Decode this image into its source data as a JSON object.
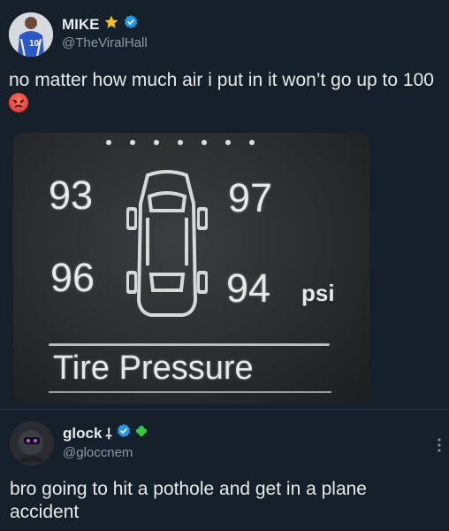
{
  "original_post": {
    "author": {
      "display_name": "MIKE",
      "handle": "@TheViralHall",
      "jersey_number": "10"
    },
    "text": "no matter how much air i put in it won’t go up to 100",
    "media": {
      "pressures": {
        "front_left": "93",
        "front_right": "97",
        "rear_left": "96",
        "rear_right": "94"
      },
      "unit": "psi",
      "label": "Tire Pressure"
    }
  },
  "reply_post": {
    "author": {
      "display_name": "glock",
      "handle": "@gloccnem"
    },
    "text": "bro going to hit a pothole and get in a plane accident"
  },
  "colors": {
    "background": "#15202b",
    "text_primary": "#e7e9ea",
    "text_secondary": "#8b98a5",
    "verified": "#1d9bf0"
  }
}
